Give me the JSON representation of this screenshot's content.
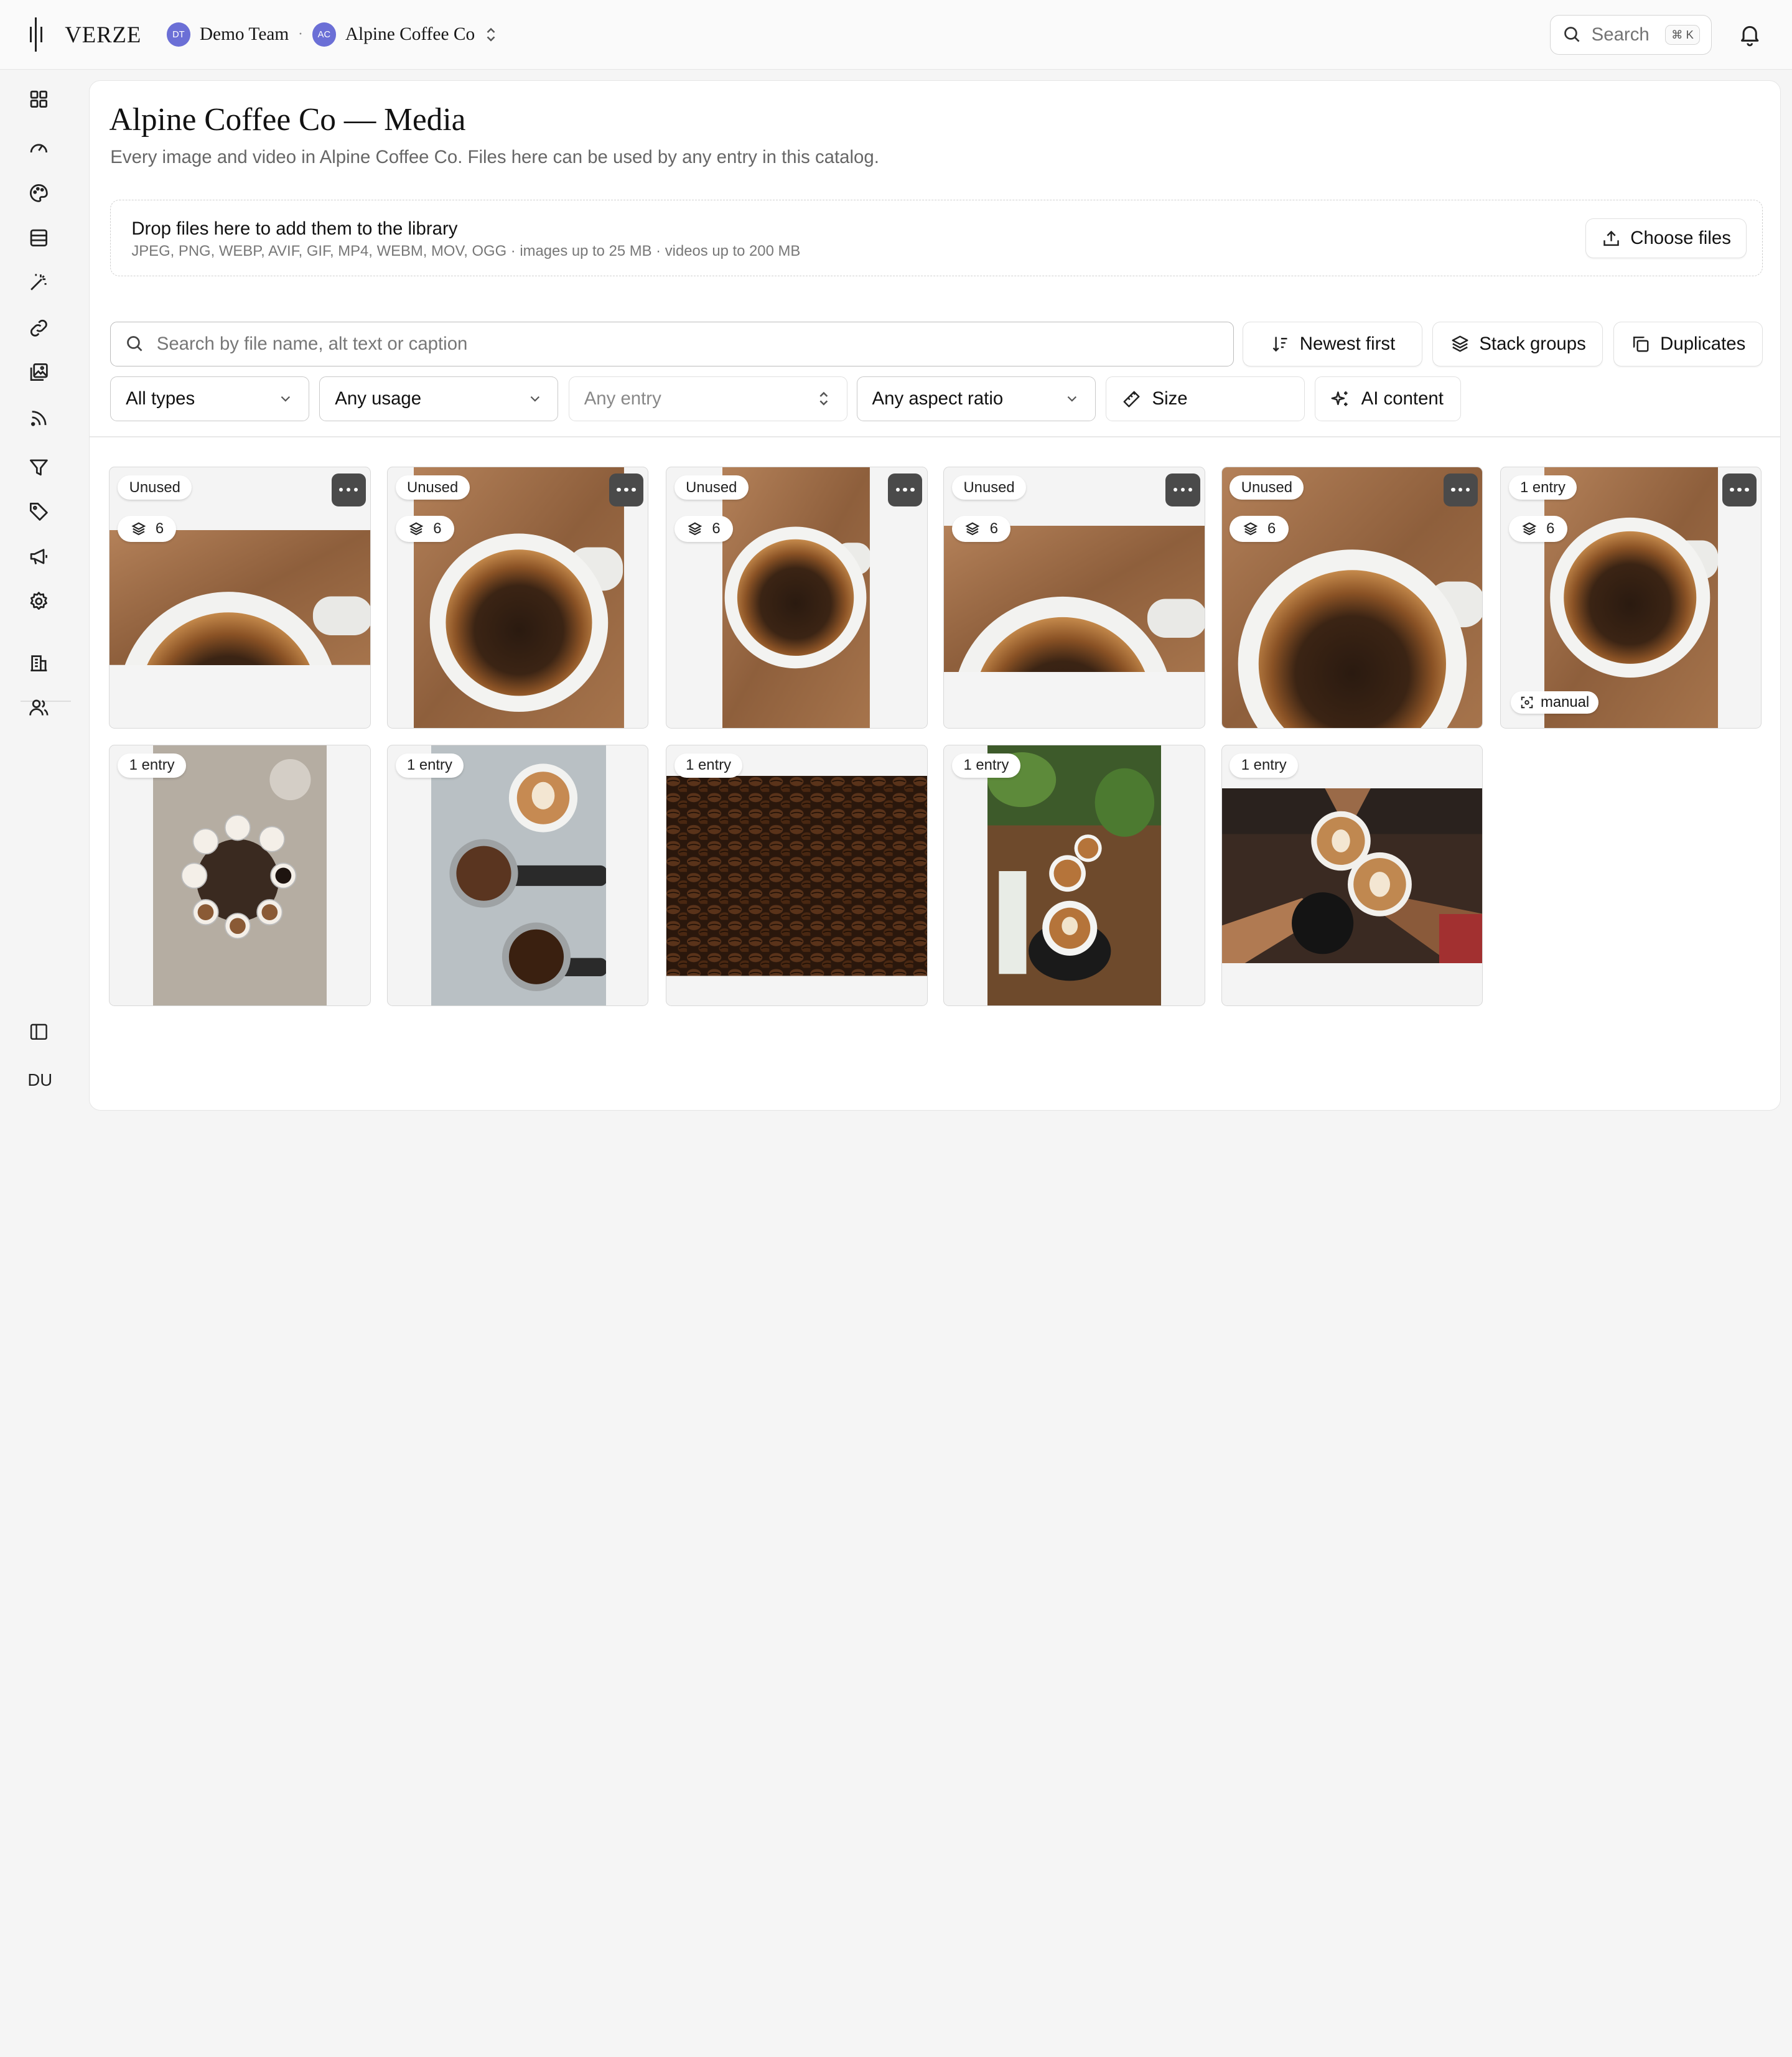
{
  "topbar": {
    "brand": "VERZE",
    "team_avatar": "DT",
    "team_name": "Demo Team",
    "separator": "·",
    "org_avatar": "AC",
    "org_name": "Alpine Coffee Co",
    "search_label": "Search",
    "search_shortcut": "⌘ K"
  },
  "sidebar": {
    "icons": [
      "dashboard-icon",
      "gauge-icon",
      "palette-icon",
      "database-icon",
      "magic-wand-icon",
      "link-icon",
      "media-library-icon",
      "rss-icon",
      "filter-icon",
      "tag-icon",
      "megaphone-icon",
      "settings-icon",
      "building-icon",
      "users-icon"
    ],
    "collapse_icon": "sidebar-toggle-icon",
    "user_initials": "DU"
  },
  "page": {
    "title": "Alpine Coffee Co — Media",
    "subtitle": "Every image and video in Alpine Coffee Co. Files here can be used by any entry in this catalog."
  },
  "dropzone": {
    "title": "Drop files here to add them to the library",
    "formats": "JPEG, PNG, WEBP, AVIF, GIF, MP4, WEBM, MOV, OGG · images up to 25 MB · videos up to 200 MB",
    "choose_label": "Choose files"
  },
  "toolbar": {
    "search_placeholder": "Search by file name, alt text or caption",
    "sort_label": "Newest first",
    "stack_label": "Stack groups",
    "duplicates_label": "Duplicates"
  },
  "filters": {
    "type": "All types",
    "usage": "Any usage",
    "entry": "Any entry",
    "aspect": "Any aspect ratio",
    "size": "Size",
    "ai": "AI content"
  },
  "media": [
    {
      "usage": "Unused",
      "stack_count": "6",
      "subject": "espresso cup"
    },
    {
      "usage": "Unused",
      "stack_count": "6",
      "subject": "espresso cup"
    },
    {
      "usage": "Unused",
      "stack_count": "6",
      "subject": "espresso cup"
    },
    {
      "usage": "Unused",
      "stack_count": "6",
      "subject": "espresso cup"
    },
    {
      "usage": "Unused",
      "stack_count": "6",
      "subject": "espresso cup"
    },
    {
      "usage": "1 entry",
      "stack_count": "6",
      "crop_mode": "manual",
      "subject": "espresso cup"
    },
    {
      "usage": "1 entry",
      "subject": "tasting cups"
    },
    {
      "usage": "1 entry",
      "subject": "latte and portafilters"
    },
    {
      "usage": "1 entry",
      "subject": "coffee beans"
    },
    {
      "usage": "1 entry",
      "subject": "cafe table lattes"
    },
    {
      "usage": "1 entry",
      "subject": "cheers lattes"
    }
  ],
  "colors": {
    "avatar": "#6b6fd6",
    "more_button": "#4a4a4a",
    "wood": "#9a6e47",
    "crema": "#b0702e"
  }
}
